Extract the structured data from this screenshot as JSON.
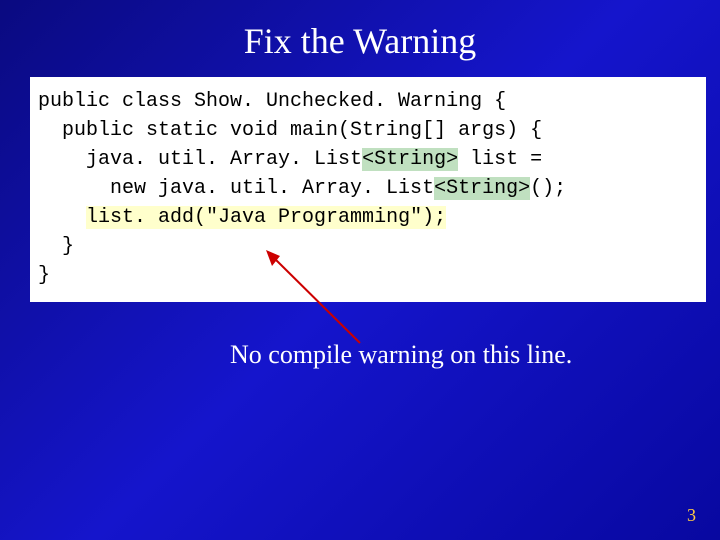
{
  "title": "Fix the Warning",
  "code": {
    "l1a": "public class Show. Unchecked. Warning {",
    "l2a": "  public static void main(String[] args) {",
    "l3a": "    java. util. Array. List",
    "l3b": "<String>",
    "l3c": " list =",
    "l4a": "      new java. util. Array. List",
    "l4b": "<String>",
    "l4c": "();",
    "l5a": "    ",
    "l5b": "list. add(\"Java Programming\");",
    "l6a": "  }",
    "l7a": "}"
  },
  "caption": "No compile warning on this line.",
  "page": "3"
}
